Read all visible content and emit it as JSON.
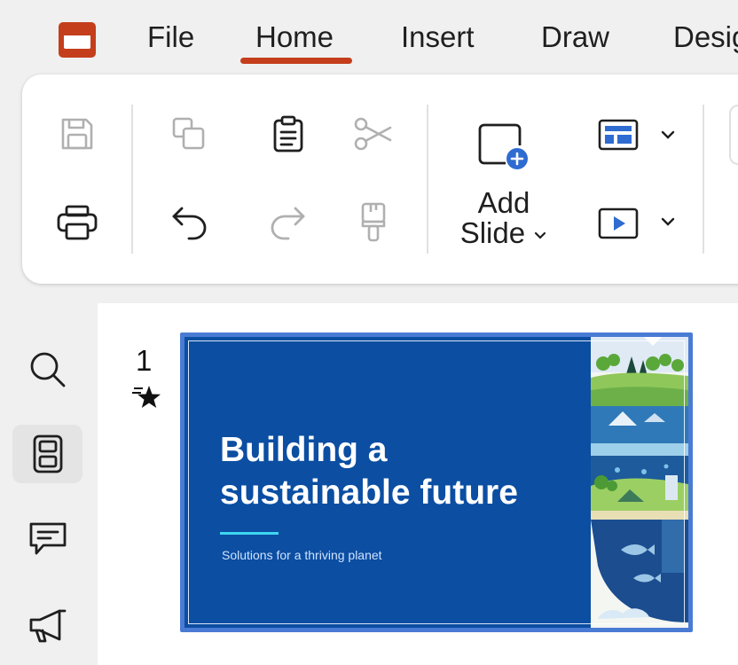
{
  "menu": {
    "tabs": [
      {
        "label": "File"
      },
      {
        "label": "Home"
      },
      {
        "label": "Insert"
      },
      {
        "label": "Draw"
      },
      {
        "label": "Desig"
      }
    ],
    "active_tab": "Home",
    "accent": "#c43e1c"
  },
  "ribbon": {
    "add_slide": {
      "line1": "Add",
      "line2": "Slide"
    },
    "icons": [
      "save-icon",
      "print-icon",
      "copy-icon",
      "undo-icon",
      "paste-icon",
      "redo-icon",
      "cut-icon",
      "format-painter-icon",
      "new-slide-icon",
      "layout-icon",
      "present-icon"
    ]
  },
  "rail": {
    "items": [
      "search-icon",
      "slides-panel-icon",
      "comments-icon",
      "megaphone-icon"
    ],
    "active": "slides-panel-icon"
  },
  "thumbnail": {
    "number": "1",
    "has_transition": true,
    "slide": {
      "title_line1": "Building a",
      "title_line2": "sustainable future",
      "subtitle": "Solutions for a thriving planet",
      "background": "#0b4ea2",
      "accent": "#3ed6f0"
    }
  }
}
